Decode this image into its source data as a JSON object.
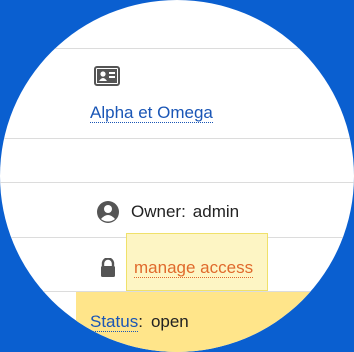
{
  "colors": {
    "background": "#0a5fd0",
    "link": "#1a56b6",
    "manage_link": "#e06a2c",
    "highlight": "#ffe58a"
  },
  "identity": {
    "icon": "id-card-icon",
    "name": "Alpha et Omega"
  },
  "owner": {
    "icon": "user-circle-icon",
    "label": "Owner:",
    "value": "admin"
  },
  "access": {
    "icon": "lock-icon",
    "label": "manage access"
  },
  "status": {
    "label": "Status",
    "separator": ":",
    "value": "open"
  }
}
